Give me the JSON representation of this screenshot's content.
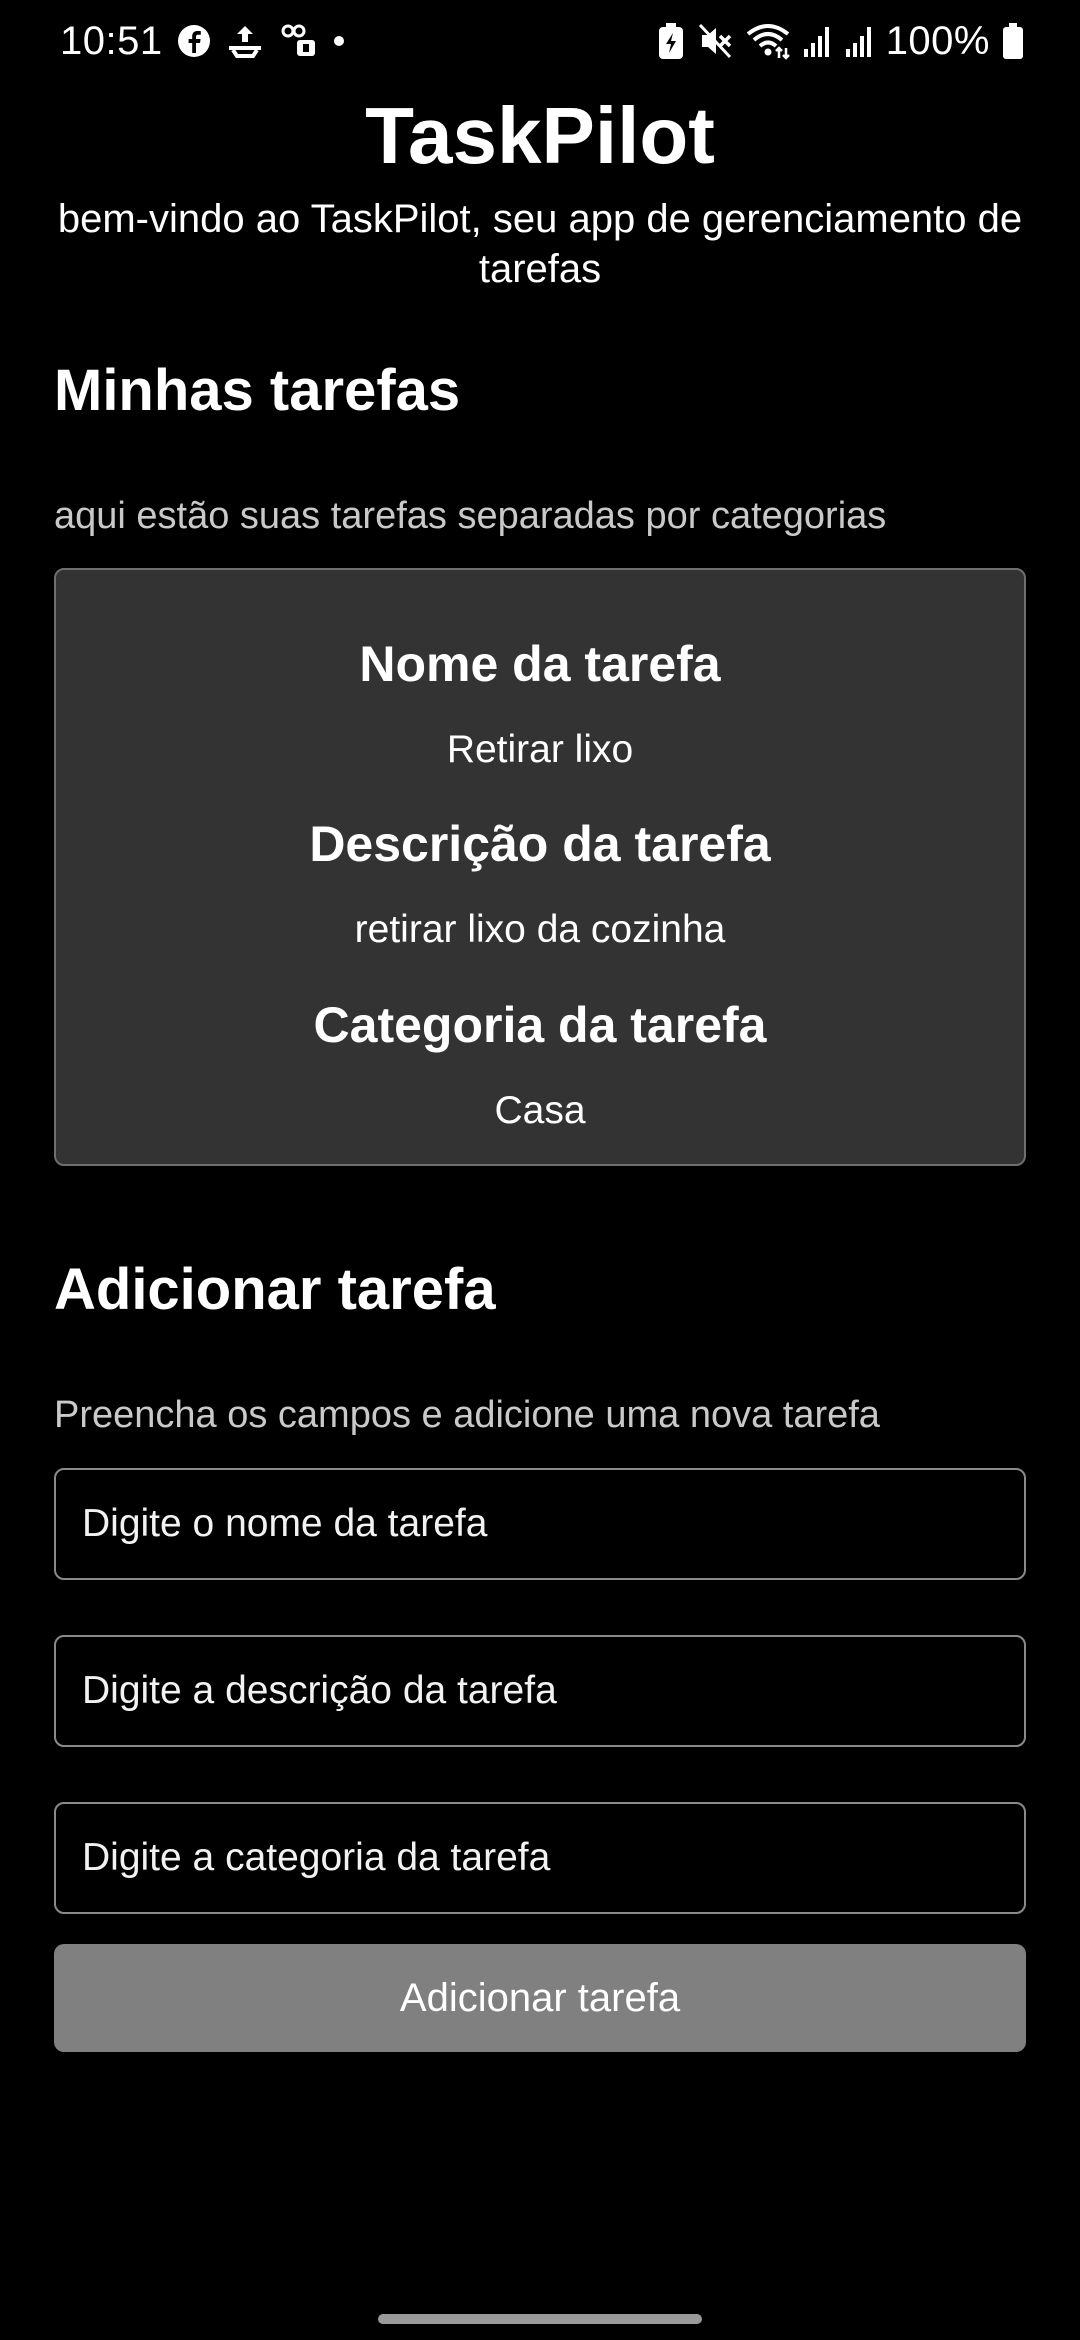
{
  "status_bar": {
    "time": "10:51",
    "battery_percent": "100%",
    "left_icons": [
      "facebook-icon",
      "upload-notification-icon",
      "app-notification-icon",
      "dot-icon"
    ],
    "right_icons": [
      "battery-saver-icon",
      "mute-icon",
      "wifi-icon",
      "signal-icon",
      "signal-icon",
      "battery-icon"
    ]
  },
  "header": {
    "title": "TaskPilot",
    "subtitle": "bem-vindo ao TaskPilot, seu app de gerenciamento de tarefas"
  },
  "tasks_section": {
    "heading": "Minhas tarefas",
    "description": "aqui estão suas tarefas separadas por categorias",
    "task": {
      "name_label": "Nome da tarefa",
      "name": "Retirar lixo",
      "description_label": "Descrição da tarefa",
      "description": "retirar lixo da cozinha",
      "category_label": "Categoria da tarefa",
      "category": "Casa"
    }
  },
  "add_section": {
    "heading": "Adicionar tarefa",
    "description": "Preencha os campos e adicione uma nova tarefa",
    "name_input": {
      "placeholder": "Digite o nome da tarefa",
      "value": ""
    },
    "description_input": {
      "placeholder": "Digite a descrição da tarefa",
      "value": ""
    },
    "category_input": {
      "placeholder": "Digite a categoria da tarefa",
      "value": ""
    },
    "submit_label": "Adicionar tarefa"
  },
  "colors": {
    "background": "#000000",
    "card_background": "#333333",
    "button_background": "#808080",
    "text": "#ffffff",
    "muted_text": "#c9c9c9"
  }
}
